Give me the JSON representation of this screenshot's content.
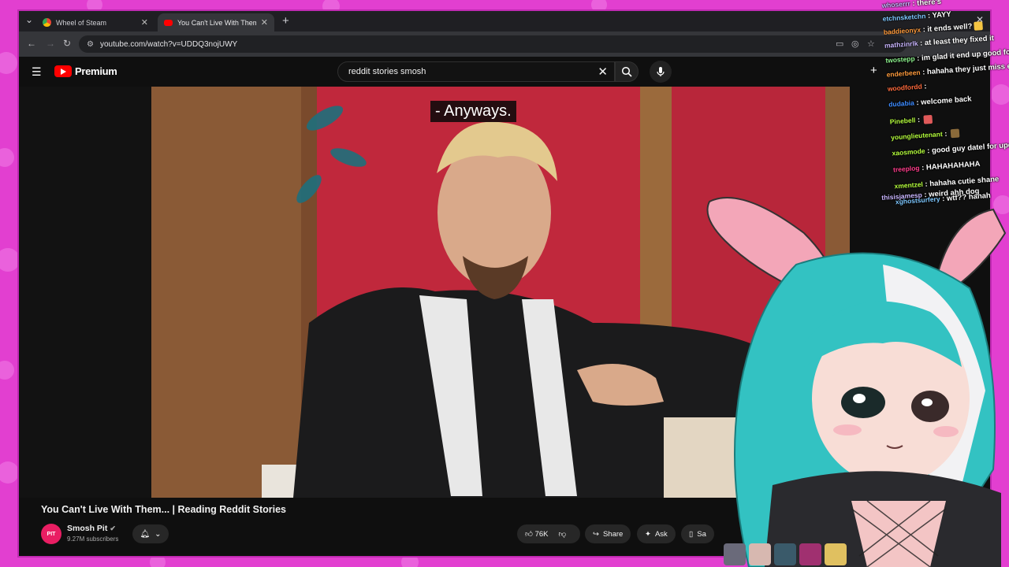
{
  "browser": {
    "tabs": [
      {
        "title": "Wheel of Steam",
        "active": false,
        "favicon_color": "#4aa3ff"
      },
      {
        "title": "You Can't Live With Them... | Re",
        "active": true,
        "favicon_color": "#ff0000"
      }
    ],
    "new_tab_icon": "plus-icon",
    "url": "youtube.com/watch?v=UDDQ3nojUWY"
  },
  "youtube": {
    "brand": "Premium",
    "search_query": "reddit stories smosh",
    "caption": "- Anyways.",
    "video_title": "You Can't Live With Them... | Reading Reddit Stories",
    "channel": {
      "name": "Smosh Pit",
      "avatar_text": "PIT",
      "subscribers": "9.27M subscribers"
    },
    "actions": {
      "likes": "76K",
      "share": "Share",
      "ask": "Ask",
      "save": "Sa"
    }
  },
  "chat": [
    {
      "user": "whoserrr",
      "text": "there's",
      "color": "#c9b6ff"
    },
    {
      "user": "etchnsketchn",
      "text": "YAYY",
      "color": "#7ec8ff"
    },
    {
      "user": "baddieonyx",
      "text": "it ends well?",
      "color": "#ff9b3d"
    },
    {
      "user": "mathzinrlk",
      "text": "at least they fixed it",
      "color": "#c9b6ff"
    },
    {
      "user": "twostepp",
      "text": "im glad it end up good fo",
      "color": "#8ef58e"
    },
    {
      "user": "enderbeen",
      "text": "hahaha they just miss ea",
      "color": "#ff9b3d"
    },
    {
      "user": "woodfordd",
      "text": "",
      "color": "#ff6b3d"
    },
    {
      "user": "dudabia",
      "text": "welcome back",
      "color": "#3d8bff"
    },
    {
      "user": "Pinebell",
      "text": "",
      "color": "#b6ff3d"
    },
    {
      "user": "younglieutenant",
      "text": "",
      "color": "#b6ff3d"
    },
    {
      "user": "xaosmode",
      "text": "good guy datel for updatin",
      "color": "#b6ff3d"
    },
    {
      "user": "treeplog",
      "text": "HAHAHAHAHA",
      "color": "#ff3d8b"
    },
    {
      "user": "xmentzel",
      "text": "hahaha cutie shane",
      "color": "#b6ff3d"
    },
    {
      "user": "xghostsurfery",
      "text": "wtf?? hahah",
      "color": "#7ec8ff"
    },
    {
      "user": "thisisjamesp",
      "text": "weird ahh dog",
      "color": "#c9b6ff"
    }
  ],
  "colors": {
    "frame": "#e23fd0",
    "youtube_red": "#ff0000",
    "avatar_hair": "#33c2c2",
    "wall_red": "#c0283c"
  }
}
